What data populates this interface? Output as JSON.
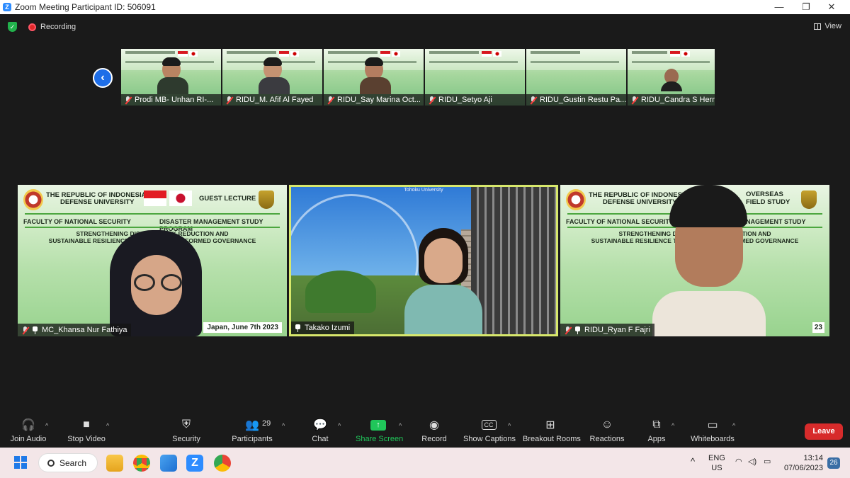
{
  "window": {
    "title": "Zoom Meeting Participant ID: 506091",
    "minimize": "—",
    "restore": "❐",
    "close": "✕"
  },
  "status": {
    "recording": "Recording",
    "view": "View"
  },
  "thumbnails": [
    {
      "name": "Prodi MB- Unhan RI-..."
    },
    {
      "name": "RIDU_M. Afif Al Fayed"
    },
    {
      "name": "RIDU_Say Marina Oct..."
    },
    {
      "name": "RIDU_Setyo Aji"
    },
    {
      "name": "RIDU_Gustin Restu Pa..."
    },
    {
      "name": "RIDU_Candra S Herm..."
    }
  ],
  "tiles": {
    "left": {
      "name": "MC_Khansa Nur Fathiya",
      "header_line1": "THE REPUBLIC OF INDONESIA",
      "header_line2": "DEFENSE UNIVERSITY",
      "header_right": "GUEST LECTURE",
      "faculty": "FACULTY OF NATIONAL SECURITY",
      "program": "DISASTER MANAGEMENT STUDY PROGRAM",
      "subtitle1": "STRENGTHENING DISASTER RISK REDUCTION AND",
      "subtitle2": "SUSTAINABLE RESILIENCE THROUGH RISK-INFORMED GOVERNANCE",
      "date": "Japan, June 7th 2023"
    },
    "center": {
      "name": "Takako Izumi",
      "banner": "Tohoku University"
    },
    "right": {
      "name": "RIDU_Ryan F Fajri",
      "header_line1": "THE REPUBLIC OF INDONESIA",
      "header_line2": "DEFENSE UNIVERSITY",
      "header_right1": "OVERSEAS",
      "header_right2": "FIELD STUDY",
      "faculty": "FACULTY OF NATIONAL SECURITY",
      "program": "DISASTER MANAGEMENT STUDY PROGRAM",
      "subtitle1": "STRENGTHENING DISASTER RISK REDUCTION AND",
      "subtitle2": "SUSTAINABLE RESILIENCE THROUGH RISK-INFORMED GOVERNANCE",
      "date_tail": "23"
    }
  },
  "toolbar": {
    "join_audio": "Join Audio",
    "stop_video": "Stop Video",
    "security": "Security",
    "participants": "Participants",
    "participants_count": "29",
    "chat": "Chat",
    "share_screen": "Share Screen",
    "record": "Record",
    "show_captions": "Show Captions",
    "captions_icon": "CC",
    "breakout_rooms": "Breakout Rooms",
    "reactions": "Reactions",
    "apps": "Apps",
    "whiteboards": "Whiteboards",
    "leave": "Leave"
  },
  "taskbar": {
    "search": "Search",
    "lang1": "ENG",
    "lang2": "US",
    "time": "13:14",
    "date": "07/06/2023",
    "notifications": "26"
  },
  "colors": {
    "accent": "#2d8cff",
    "share": "#20c65a",
    "leave": "#d72b2b",
    "speaker_border": "#d8e86c"
  }
}
